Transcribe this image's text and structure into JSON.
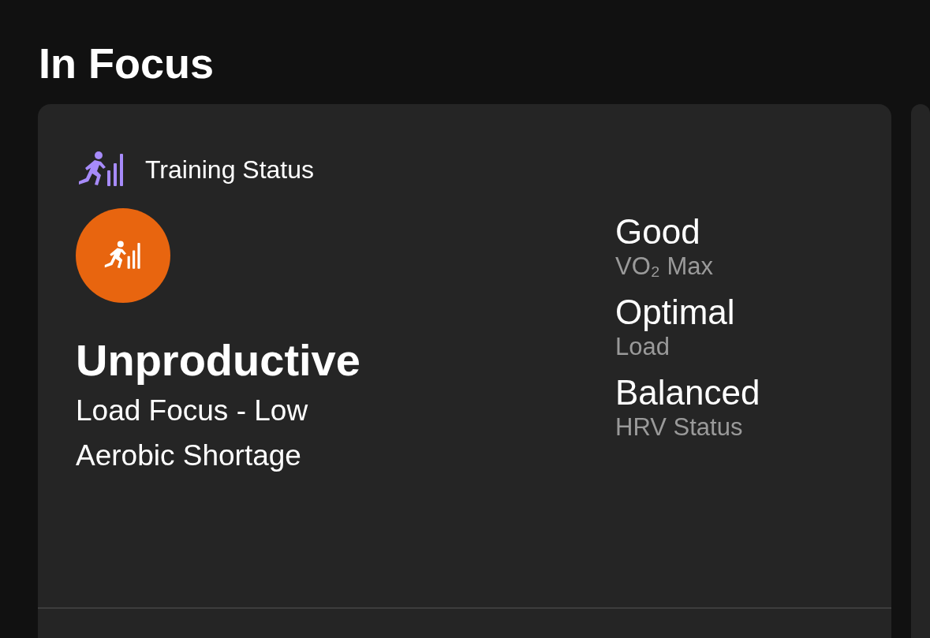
{
  "section_title": "In Focus",
  "card": {
    "title": "Training Status",
    "color": "#e8650f",
    "status": "Unproductive",
    "description": "Load Focus - Low Aerobic Shortage",
    "metrics": [
      {
        "value": "Good",
        "label": "VO₂ Max"
      },
      {
        "value": "Optimal",
        "label": "Load"
      },
      {
        "value": "Balanced",
        "label": "HRV Status"
      }
    ]
  }
}
